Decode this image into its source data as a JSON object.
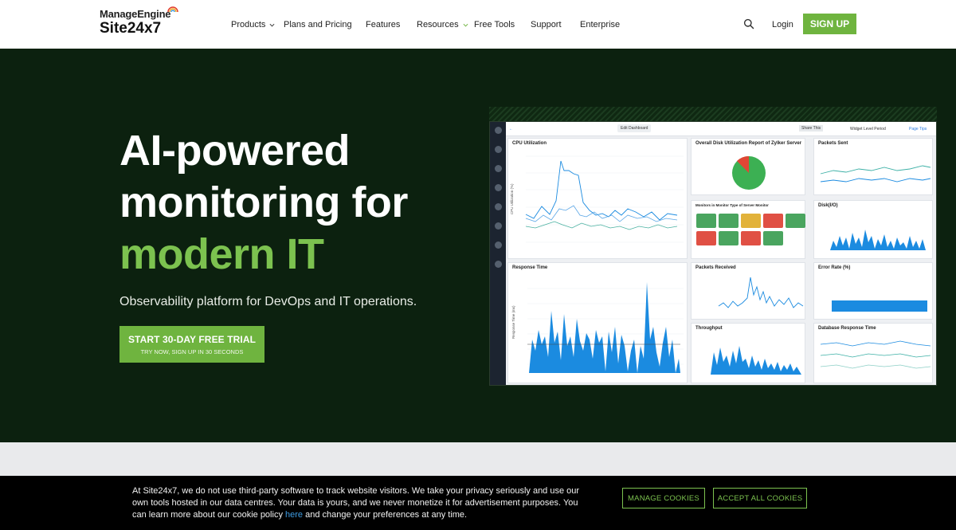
{
  "header": {
    "logo_top": "ManageEngine",
    "logo_bottom": "Site24x7",
    "nav": [
      {
        "label": "Products",
        "has_dropdown": true
      },
      {
        "label": "Plans and Pricing",
        "has_dropdown": false
      },
      {
        "label": "Features",
        "has_dropdown": false
      },
      {
        "label": "Resources",
        "has_dropdown": true
      },
      {
        "label": "Free Tools",
        "has_dropdown": false
      },
      {
        "label": "Support",
        "has_dropdown": false
      },
      {
        "label": "Enterprise",
        "has_dropdown": false
      }
    ],
    "search_icon": "search-icon",
    "login": "Login",
    "signup": "SIGN UP"
  },
  "hero": {
    "line1": "AI-powered",
    "line2": "monitoring for",
    "line3": "modern IT",
    "subtitle": "Observability platform for DevOps and IT operations.",
    "cta_main": "START 30-DAY FREE TRIAL",
    "cta_sub": "TRY NOW, SIGN UP IN 30 SECONDS"
  },
  "dashboard": {
    "edit_label": "Edit Dashboard",
    "share_label": "Share This",
    "period_label": "Widget Level Period",
    "page_tips": "Page Tips",
    "widgets": {
      "cpu": "CPU Utilization",
      "disk_util": "Overall Disk Utilization Report of Zylker Server",
      "packets_sent": "Packets Sent",
      "monitors": "Monitors in Monitor Type of Server Monitor",
      "disk_io": "Disk(I/O)",
      "response_time": "Response Time",
      "packets_received": "Packets Received",
      "error_rate": "Error Rate (%)",
      "throughput": "Throughput",
      "db_response": "Database Response Time"
    }
  },
  "cookie": {
    "text_before": "At Site24x7, we do not use third-party software to track website visitors. We take your privacy seriously and use our own tools hosted in our data centres. Your data is yours, and we never monetize it for advertisement purposes. You can learn more about our cookie policy ",
    "link": "here",
    "text_after": " and change your preferences at any time.",
    "manage": "MANAGE COOKIES",
    "accept": "ACCEPT ALL COOKIES"
  },
  "colors": {
    "brand_green": "#6fb43f",
    "accent_green": "#7cc24f",
    "hero_bg": "#0c210f",
    "chart_blue": "#1b8be0"
  }
}
